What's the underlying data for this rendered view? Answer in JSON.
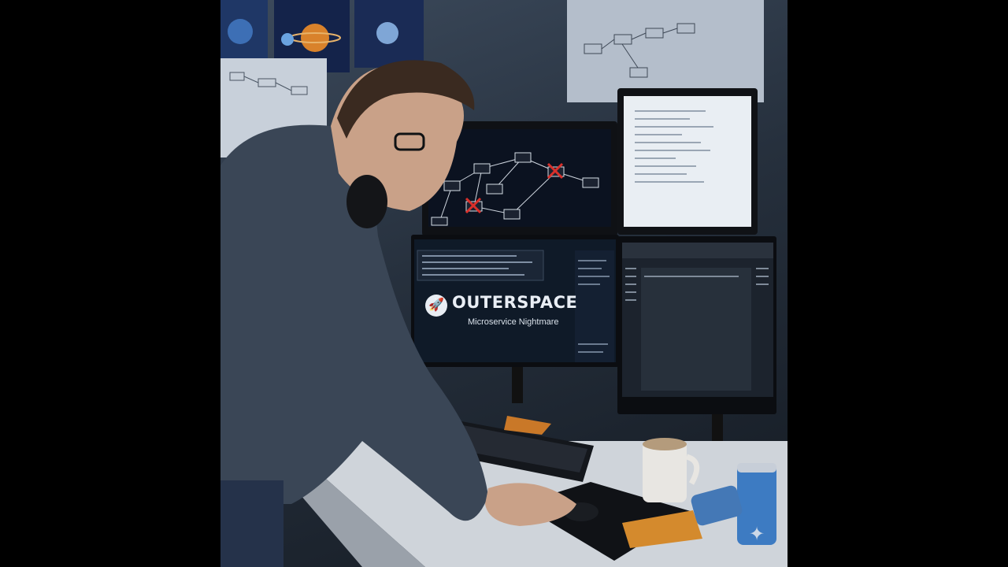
{
  "brand": {
    "title": "OUTERSPACE",
    "subtitle": "Microservice Nightmare",
    "logo_icon": "rocket-icon"
  },
  "watermark": {
    "icon": "sparkle-icon"
  },
  "colors": {
    "background": "#000000",
    "wall": "#2f3b4a",
    "screen_dark": "#0d1622",
    "screen_light": "#e9eef3",
    "error_mark": "#d9302b",
    "hoodie": "#3a4656"
  }
}
